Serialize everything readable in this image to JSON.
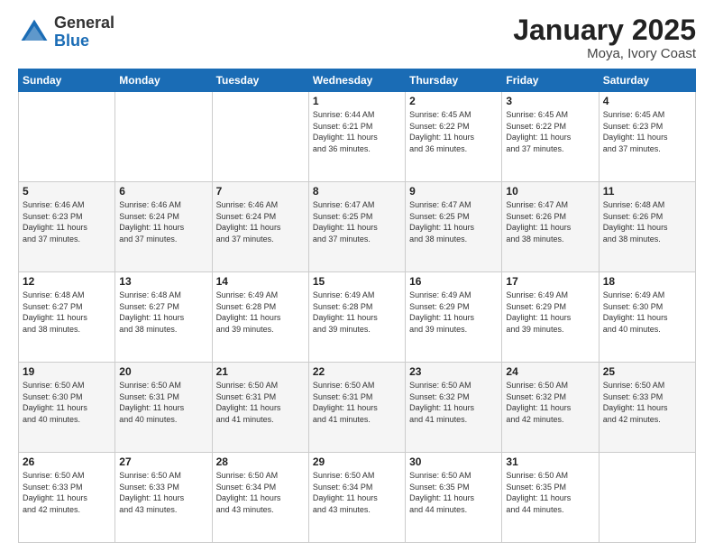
{
  "logo": {
    "general": "General",
    "blue": "Blue"
  },
  "title": {
    "month_year": "January 2025",
    "location": "Moya, Ivory Coast"
  },
  "weekdays": [
    "Sunday",
    "Monday",
    "Tuesday",
    "Wednesday",
    "Thursday",
    "Friday",
    "Saturday"
  ],
  "weeks": [
    [
      {
        "day": "",
        "info": ""
      },
      {
        "day": "",
        "info": ""
      },
      {
        "day": "",
        "info": ""
      },
      {
        "day": "1",
        "info": "Sunrise: 6:44 AM\nSunset: 6:21 PM\nDaylight: 11 hours\nand 36 minutes."
      },
      {
        "day": "2",
        "info": "Sunrise: 6:45 AM\nSunset: 6:22 PM\nDaylight: 11 hours\nand 36 minutes."
      },
      {
        "day": "3",
        "info": "Sunrise: 6:45 AM\nSunset: 6:22 PM\nDaylight: 11 hours\nand 37 minutes."
      },
      {
        "day": "4",
        "info": "Sunrise: 6:45 AM\nSunset: 6:23 PM\nDaylight: 11 hours\nand 37 minutes."
      }
    ],
    [
      {
        "day": "5",
        "info": "Sunrise: 6:46 AM\nSunset: 6:23 PM\nDaylight: 11 hours\nand 37 minutes."
      },
      {
        "day": "6",
        "info": "Sunrise: 6:46 AM\nSunset: 6:24 PM\nDaylight: 11 hours\nand 37 minutes."
      },
      {
        "day": "7",
        "info": "Sunrise: 6:46 AM\nSunset: 6:24 PM\nDaylight: 11 hours\nand 37 minutes."
      },
      {
        "day": "8",
        "info": "Sunrise: 6:47 AM\nSunset: 6:25 PM\nDaylight: 11 hours\nand 37 minutes."
      },
      {
        "day": "9",
        "info": "Sunrise: 6:47 AM\nSunset: 6:25 PM\nDaylight: 11 hours\nand 38 minutes."
      },
      {
        "day": "10",
        "info": "Sunrise: 6:47 AM\nSunset: 6:26 PM\nDaylight: 11 hours\nand 38 minutes."
      },
      {
        "day": "11",
        "info": "Sunrise: 6:48 AM\nSunset: 6:26 PM\nDaylight: 11 hours\nand 38 minutes."
      }
    ],
    [
      {
        "day": "12",
        "info": "Sunrise: 6:48 AM\nSunset: 6:27 PM\nDaylight: 11 hours\nand 38 minutes."
      },
      {
        "day": "13",
        "info": "Sunrise: 6:48 AM\nSunset: 6:27 PM\nDaylight: 11 hours\nand 38 minutes."
      },
      {
        "day": "14",
        "info": "Sunrise: 6:49 AM\nSunset: 6:28 PM\nDaylight: 11 hours\nand 39 minutes."
      },
      {
        "day": "15",
        "info": "Sunrise: 6:49 AM\nSunset: 6:28 PM\nDaylight: 11 hours\nand 39 minutes."
      },
      {
        "day": "16",
        "info": "Sunrise: 6:49 AM\nSunset: 6:29 PM\nDaylight: 11 hours\nand 39 minutes."
      },
      {
        "day": "17",
        "info": "Sunrise: 6:49 AM\nSunset: 6:29 PM\nDaylight: 11 hours\nand 39 minutes."
      },
      {
        "day": "18",
        "info": "Sunrise: 6:49 AM\nSunset: 6:30 PM\nDaylight: 11 hours\nand 40 minutes."
      }
    ],
    [
      {
        "day": "19",
        "info": "Sunrise: 6:50 AM\nSunset: 6:30 PM\nDaylight: 11 hours\nand 40 minutes."
      },
      {
        "day": "20",
        "info": "Sunrise: 6:50 AM\nSunset: 6:31 PM\nDaylight: 11 hours\nand 40 minutes."
      },
      {
        "day": "21",
        "info": "Sunrise: 6:50 AM\nSunset: 6:31 PM\nDaylight: 11 hours\nand 41 minutes."
      },
      {
        "day": "22",
        "info": "Sunrise: 6:50 AM\nSunset: 6:31 PM\nDaylight: 11 hours\nand 41 minutes."
      },
      {
        "day": "23",
        "info": "Sunrise: 6:50 AM\nSunset: 6:32 PM\nDaylight: 11 hours\nand 41 minutes."
      },
      {
        "day": "24",
        "info": "Sunrise: 6:50 AM\nSunset: 6:32 PM\nDaylight: 11 hours\nand 42 minutes."
      },
      {
        "day": "25",
        "info": "Sunrise: 6:50 AM\nSunset: 6:33 PM\nDaylight: 11 hours\nand 42 minutes."
      }
    ],
    [
      {
        "day": "26",
        "info": "Sunrise: 6:50 AM\nSunset: 6:33 PM\nDaylight: 11 hours\nand 42 minutes."
      },
      {
        "day": "27",
        "info": "Sunrise: 6:50 AM\nSunset: 6:33 PM\nDaylight: 11 hours\nand 43 minutes."
      },
      {
        "day": "28",
        "info": "Sunrise: 6:50 AM\nSunset: 6:34 PM\nDaylight: 11 hours\nand 43 minutes."
      },
      {
        "day": "29",
        "info": "Sunrise: 6:50 AM\nSunset: 6:34 PM\nDaylight: 11 hours\nand 43 minutes."
      },
      {
        "day": "30",
        "info": "Sunrise: 6:50 AM\nSunset: 6:35 PM\nDaylight: 11 hours\nand 44 minutes."
      },
      {
        "day": "31",
        "info": "Sunrise: 6:50 AM\nSunset: 6:35 PM\nDaylight: 11 hours\nand 44 minutes."
      },
      {
        "day": "",
        "info": ""
      }
    ]
  ]
}
